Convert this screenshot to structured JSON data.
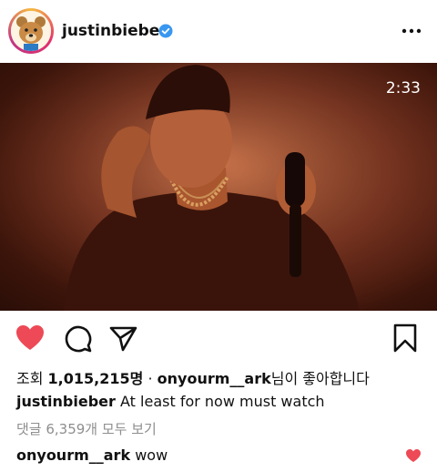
{
  "header": {
    "username": "justinbieber",
    "verified_color": "#3897f0"
  },
  "video": {
    "duration": "2:33",
    "muted": true
  },
  "actions": {
    "liked": true,
    "like_color": "#ed4956"
  },
  "post": {
    "views_label": "조회",
    "views_count": "1,015,215명",
    "separator": "·",
    "liked_by_user": "onyourm__ark",
    "liked_by_suffix": "님이 좋아합니다",
    "caption_user": "justinbieber",
    "caption_text": "At least for now must watch",
    "comments_link": "댓글 6,359개 모두 보기"
  },
  "comment": {
    "user": "onyourm__ark",
    "text": "wow"
  }
}
